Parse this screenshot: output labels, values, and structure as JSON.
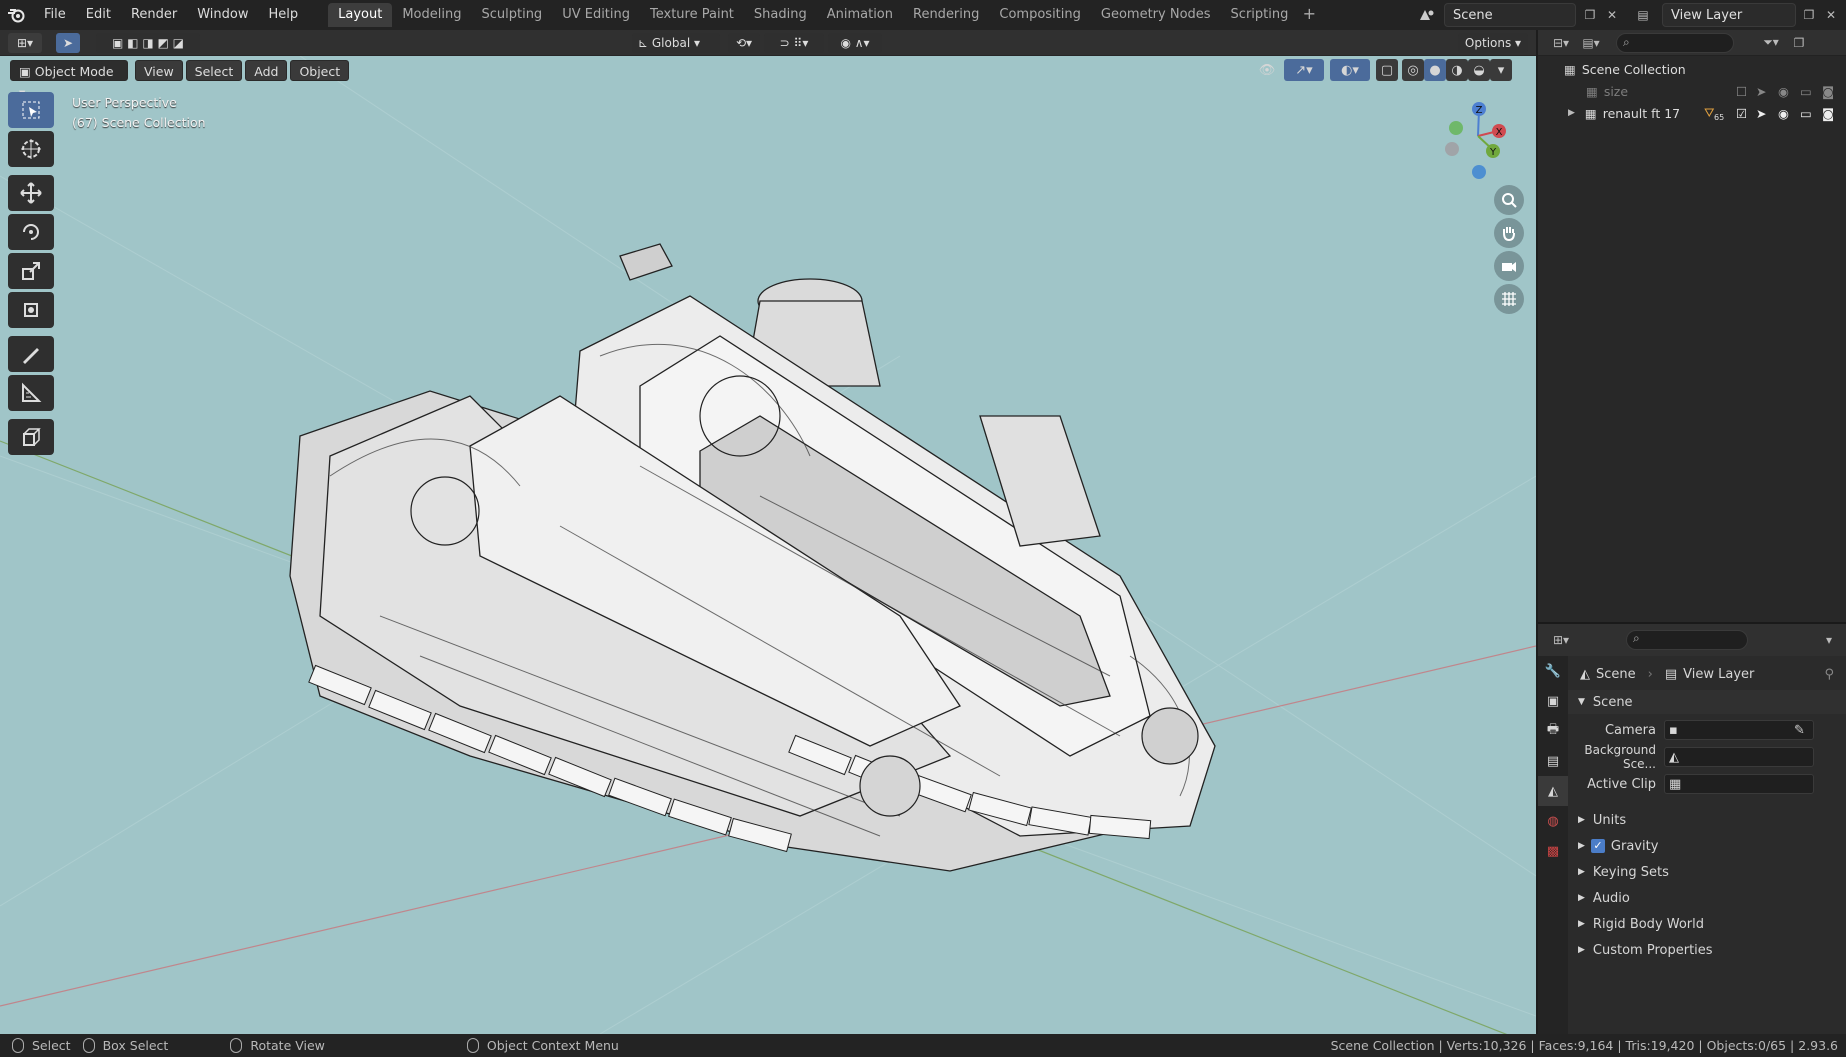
{
  "topbar": {
    "menus": [
      "File",
      "Edit",
      "Render",
      "Window",
      "Help"
    ],
    "workspaces": [
      "Layout",
      "Modeling",
      "Sculpting",
      "UV Editing",
      "Texture Paint",
      "Shading",
      "Animation",
      "Rendering",
      "Compositing",
      "Geometry Nodes",
      "Scripting"
    ],
    "active_workspace": "Layout",
    "scene_name": "Scene",
    "view_layer_name": "View Layer"
  },
  "tool_header": {
    "transform_orientation": "Global",
    "options_label": "Options"
  },
  "viewport": {
    "mode_label": "Object Mode",
    "menu": [
      "View",
      "Select",
      "Add",
      "Object"
    ],
    "perspective_label": "User Perspective",
    "collection_label": "(67) Scene Collection",
    "gizmo_axes": {
      "x": "X",
      "y": "Y",
      "z": "Z"
    },
    "background_color": "#a0c5c8"
  },
  "toolbar": {
    "tools": [
      "select-box-icon",
      "cursor-icon",
      "move-icon",
      "rotate-icon",
      "scale-icon",
      "transform-icon",
      "annotate-icon",
      "measure-icon",
      "add-cube-icon"
    ]
  },
  "outliner": {
    "root": "Scene Collection",
    "items": [
      {
        "name": "size",
        "dim": true
      },
      {
        "name": "renault ft 17",
        "dim": false,
        "badge": "65"
      }
    ]
  },
  "properties": {
    "breadcrumb_scene": "Scene",
    "breadcrumb_layer": "View Layer",
    "panel_title": "Scene",
    "fields": [
      {
        "label": "Camera",
        "value": ""
      },
      {
        "label": "Background Sce...",
        "value": ""
      },
      {
        "label": "Active Clip",
        "value": ""
      }
    ],
    "subpanels": [
      {
        "label": "Units",
        "checkbox": false
      },
      {
        "label": "Gravity",
        "checkbox": true
      },
      {
        "label": "Keying Sets",
        "checkbox": false
      },
      {
        "label": "Audio",
        "checkbox": false
      },
      {
        "label": "Rigid Body World",
        "checkbox": false
      },
      {
        "label": "Custom Properties",
        "checkbox": false
      }
    ]
  },
  "statusbar": {
    "select": "Select",
    "box_select": "Box Select",
    "rotate_view": "Rotate View",
    "context_menu": "Object Context Menu",
    "stats": "Scene Collection | Verts:10,326 | Faces:9,164 | Tris:19,420 | Objects:0/65 | 2.93.6"
  }
}
